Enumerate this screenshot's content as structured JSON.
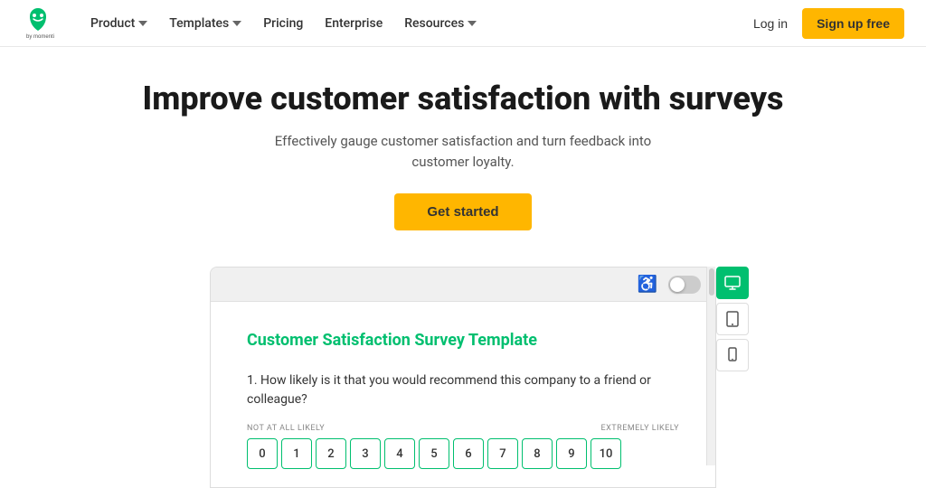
{
  "navbar": {
    "logo_alt": "SurveyMonkey by Momentive",
    "nav_items": [
      {
        "label": "Product",
        "has_dropdown": true
      },
      {
        "label": "Templates",
        "has_dropdown": true
      },
      {
        "label": "Pricing",
        "has_dropdown": false
      },
      {
        "label": "Enterprise",
        "has_dropdown": false
      },
      {
        "label": "Resources",
        "has_dropdown": true
      }
    ],
    "login_label": "Log in",
    "signup_label": "Sign up free"
  },
  "hero": {
    "title": "Improve customer satisfaction with surveys",
    "subtitle": "Effectively gauge customer satisfaction and turn feedback into customer loyalty.",
    "cta_label": "Get started"
  },
  "preview": {
    "survey_title": "Customer Satisfaction Survey Template",
    "question": "1. How likely is it that you would recommend this company to a friend or colleague?",
    "scale_low_label": "NOT AT ALL LIKELY",
    "scale_high_label": "EXTREMELY LIKELY",
    "scale_numbers": [
      "0",
      "1",
      "2",
      "3",
      "4",
      "5",
      "6",
      "7",
      "8",
      "9",
      "10"
    ]
  },
  "devices": [
    {
      "label": "desktop",
      "icon": "🖥"
    },
    {
      "label": "tablet",
      "icon": "⬛"
    },
    {
      "label": "mobile",
      "icon": "📱"
    }
  ],
  "colors": {
    "green": "#00bf6f",
    "yellow": "#ffb600"
  }
}
